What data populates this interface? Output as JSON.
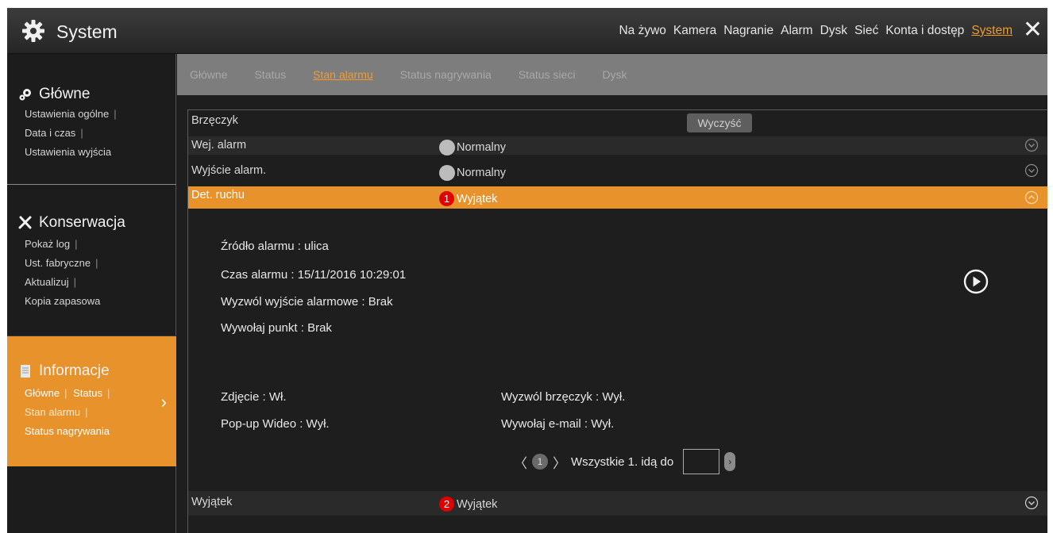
{
  "header": {
    "title": "System",
    "nav": [
      "Na żywo",
      "Kamera",
      "Nagranie",
      "Alarm",
      "Dysk",
      "Sieć",
      "Konta i dostęp",
      "System"
    ],
    "nav_active": "System"
  },
  "sidebar": {
    "sections": [
      {
        "title": "Główne",
        "items": [
          "Ustawienia ogólne",
          "Data i czas",
          "Ustawienia wyjścia"
        ]
      },
      {
        "title": "Konserwacja",
        "items": [
          "Pokaż log",
          "Ust. fabryczne",
          "Aktualizuj",
          "Kopia zapasowa"
        ]
      },
      {
        "title": "Informacje",
        "items_line1": [
          "Główne",
          "Status"
        ],
        "items_line2": "Stan alarmu",
        "items_line3": "Status nagrywania"
      }
    ]
  },
  "subtabs": [
    "Główne",
    "Status",
    "Stan alarmu",
    "Status nagrywania",
    "Status sieci",
    "Dysk"
  ],
  "subtab_active": "Stan alarmu",
  "rows": [
    {
      "label": "Brzęczyk",
      "button": "Wyczyść"
    },
    {
      "label": "Wej. alarm",
      "status": "Normalny"
    },
    {
      "label": "Wyjście alarm.",
      "status": "Normalny"
    },
    {
      "label": "Det. ruchu",
      "count": "1",
      "status": "Wyjątek"
    },
    {
      "label": "Wyjątek",
      "count": "2",
      "status": "Wyjątek"
    }
  ],
  "detail": {
    "source": "Źródło alarmu : ulica",
    "time": "Czas alarmu : 15/11/2016 10:29:01",
    "trigger_output": "Wyzwól wyjście alarmowe : Brak",
    "call_point": "Wywołaj punkt : Brak",
    "snapshot": "Zdjęcie : Wł.",
    "popup_video": "Pop-up Wideo : Wył.",
    "buzzer": "Wyzwól brzęczyk : Wył.",
    "email": "Wywołaj e-mail : Wył."
  },
  "pager": {
    "page": "1",
    "total_text": "Wszystkie 1. idą do",
    "input_value": ""
  },
  "colors": {
    "accent": "#e8922c",
    "topbar": "#333333",
    "subtabs": "#7d7d7d",
    "badge": "#e00000"
  }
}
